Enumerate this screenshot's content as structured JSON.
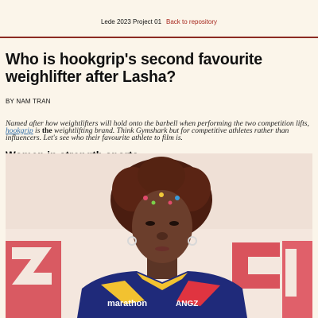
{
  "topbar": {
    "project": "Lede 2023 Project 01",
    "back_link": "Back to repository"
  },
  "article": {
    "title": "Who is hookgrip's second favourite weighlifter after Lasha?",
    "byline": "BY NAM TRAN",
    "intro_before_link": "Named after how weightlifters will hold onto the barbell when performing the two competition lifts, ",
    "intro_link": "hookgrip",
    "intro_is": " is ",
    "intro_the": "the",
    "intro_after": " weightlifting brand. Think Gymshark but for competitive athletes rather than influencers. Let's see who their favourite athlete to film is.",
    "section_heading": "Women in strength sports"
  },
  "photo": {
    "jersey_sponsor": "marathon",
    "jersey_logo": "ANGZ"
  },
  "colors": {
    "background": "#fbf5ea",
    "accent_red": "#a8281f",
    "link_blue": "#2f6ca8"
  }
}
